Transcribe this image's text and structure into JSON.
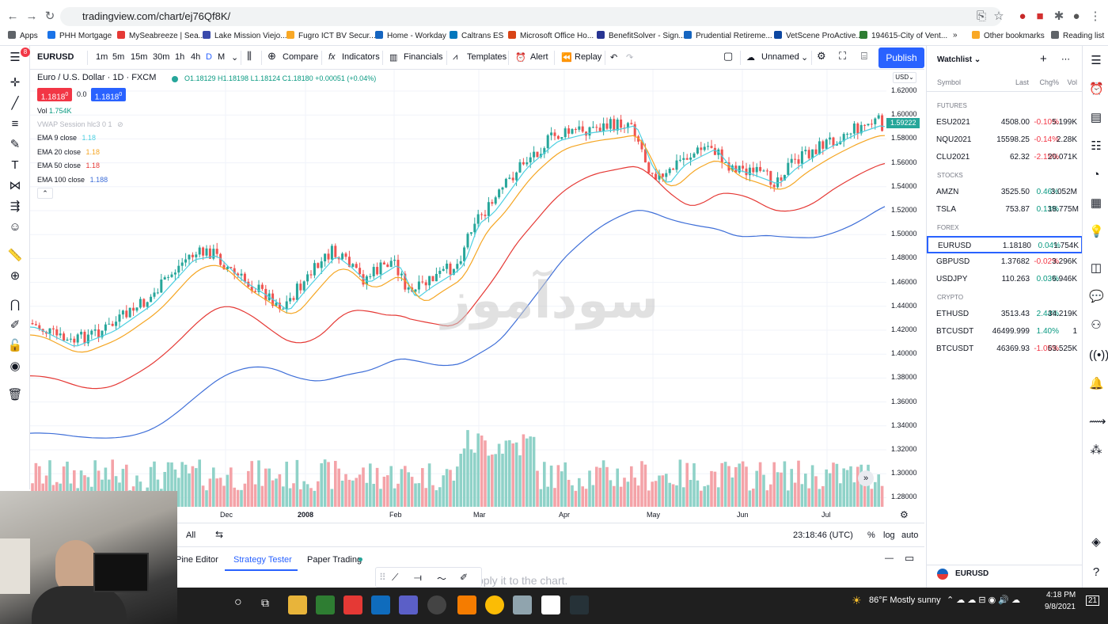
{
  "browser": {
    "url": "tradingview.com/chart/ej76Qf8K/",
    "bookmarks": [
      "Apps",
      "PHH Mortgage",
      "MySeabreeze | Sea...",
      "Lake Mission Viejo...",
      "Fugro ICT BV Secur...",
      "Home - Workday",
      "Caltrans ES",
      "Microsoft Office Ho...",
      "BenefitSolver - Sign...",
      "Prudential Retireme...",
      "VetScene ProActive...",
      "194615-City of Vent..."
    ],
    "other_bookmarks": "Other bookmarks",
    "reading_list": "Reading list"
  },
  "toolbar": {
    "symbol": "EURUSD",
    "intervals": [
      "1m",
      "5m",
      "15m",
      "30m",
      "1h",
      "4h",
      "D",
      "M"
    ],
    "compare": "Compare",
    "indicators": "Indicators",
    "financials": "Financials",
    "templates": "Templates",
    "alert": "Alert",
    "replay": "Replay",
    "layout_name": "Unnamed",
    "publish": "Publish",
    "notif_badge": "8"
  },
  "legend": {
    "title": "Euro / U.S. Dollar · 1D · FXCM",
    "ohlc": "O1.18129 H1.18198 L1.18124 C1.18180 +0.00051 (+0.04%)",
    "sell_price": "1.1818",
    "sell_sup": "0",
    "spread": "0.0",
    "buy_price": "1.1818",
    "buy_sup": "0",
    "vol_label": "Vol",
    "vol_value": "1.754K",
    "vwap": "VWAP Session hlc3 0 1",
    "emas": [
      {
        "label": "EMA 9 close",
        "value": "1.18",
        "color": "#4dd0e1"
      },
      {
        "label": "EMA 20 close",
        "value": "1.18",
        "color": "#f5a623"
      },
      {
        "label": "EMA 50 close",
        "value": "1.18",
        "color": "#e53935"
      },
      {
        "label": "EMA 100 close",
        "value": "1.188",
        "color": "#3f6fd8"
      }
    ],
    "currency": "USD"
  },
  "price_scale": {
    "ticks": [
      "1.62000",
      "1.60000",
      "1.58000",
      "1.56000",
      "1.54000",
      "1.52000",
      "1.50000",
      "1.48000",
      "1.46000",
      "1.44000",
      "1.42000",
      "1.40000",
      "1.38000",
      "1.36000",
      "1.34000",
      "1.32000",
      "1.30000",
      "1.28000"
    ],
    "current": "1.59222"
  },
  "time_scale": [
    "Dec",
    "2008",
    "Feb",
    "Mar",
    "Apr",
    "May",
    "Jun",
    "Jul"
  ],
  "chart_bottom": {
    "all_label": "All",
    "clock": "23:18:46 (UTC)",
    "pct": "%",
    "log": "log",
    "auto": "auto"
  },
  "panel_tabs": [
    "Pine Editor",
    "Strategy Tester",
    "Paper Trading"
  ],
  "panel_hint": "pply it to the chart.",
  "watermark": "سودآموز",
  "watchlist": {
    "title": "Watchlist",
    "headers": [
      "Symbol",
      "Last",
      "Chg%",
      "Vol"
    ],
    "sections": [
      {
        "name": "FUTURES",
        "rows": [
          {
            "symbol": "ESU2021",
            "last": "4508.00",
            "chg": "-0.10%",
            "vol": "5.199K",
            "dir": "down"
          },
          {
            "symbol": "NQU2021",
            "last": "15598.25",
            "chg": "-0.14%",
            "vol": "2.28K",
            "dir": "down"
          },
          {
            "symbol": "CLU2021",
            "last": "62.32",
            "chg": "-2.15%",
            "vol": "20.071K",
            "dir": "down"
          }
        ]
      },
      {
        "name": "STOCKS",
        "rows": [
          {
            "symbol": "AMZN",
            "last": "3525.50",
            "chg": "0.46%",
            "vol": "3.052M",
            "dir": "up"
          },
          {
            "symbol": "TSLA",
            "last": "753.87",
            "chg": "0.13%",
            "vol": "18.775M",
            "dir": "up"
          }
        ]
      },
      {
        "name": "FOREX",
        "rows": [
          {
            "symbol": "EURUSD",
            "last": "1.18180",
            "chg": "0.04%",
            "vol": "1.754K",
            "dir": "up"
          },
          {
            "symbol": "GBPUSD",
            "last": "1.37682",
            "chg": "-0.02%",
            "vol": "3.296K",
            "dir": "down"
          },
          {
            "symbol": "USDJPY",
            "last": "110.263",
            "chg": "0.03%",
            "vol": "6.946K",
            "dir": "up"
          }
        ]
      },
      {
        "name": "CRYPTO",
        "rows": [
          {
            "symbol": "ETHUSD",
            "last": "3513.43",
            "chg": "2.44%",
            "vol": "34.219K",
            "dir": "up"
          },
          {
            "symbol": "BTCUSDT",
            "last": "46499.999",
            "chg": "1.40%",
            "vol": "1",
            "dir": "up"
          },
          {
            "symbol": "BTCUSDT",
            "last": "46369.93",
            "chg": "-1.05%",
            "vol": "63.525K",
            "dir": "down"
          }
        ]
      }
    ],
    "footer_symbol": "EURUSD"
  },
  "taskbar": {
    "weather": "86°F  Mostly sunny",
    "time": "4:18 PM",
    "date": "9/8/2021",
    "notif": "21"
  }
}
